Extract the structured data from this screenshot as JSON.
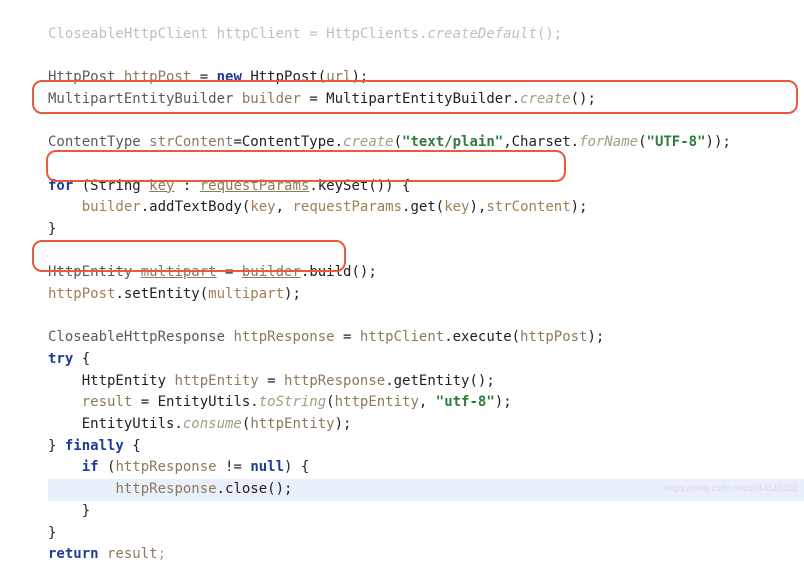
{
  "code": {
    "l00a": "CloseableHttpClient ",
    "l00b": "httpClient",
    "l00c": " = HttpClients.",
    "l00d": "createDefault",
    "l00e": "();",
    "l02a": "HttpPost ",
    "l02b": "httpPost",
    "l02c": " = ",
    "l02d": "new",
    "l02e": " HttpPost(",
    "l02f": "url",
    "l02g": ");",
    "l03a": "MultipartEntityBuilder ",
    "l03b": "builder",
    "l03c": " = MultipartEntityBuilder.",
    "l03d": "create",
    "l03e": "();",
    "l05a": "ContentType ",
    "l05b": "strContent",
    "l05c": "=ContentType.",
    "l05d": "create",
    "l05e": "(",
    "l05f": "\"text/plain\"",
    "l05g": ",Charset.",
    "l05h": "forName",
    "l05i": "(",
    "l05j": "\"UTF-8\"",
    "l05k": "));",
    "l07a": "for",
    "l07b": " (String ",
    "l07c": "key",
    "l07d": " : ",
    "l07e": "requestParams",
    "l07f": ".keySet()) {",
    "l08a": "    ",
    "l08b": "builder",
    "l08c": ".addTextBody(",
    "l08d": "key",
    "l08e": ", ",
    "l08f": "requestParams",
    "l08g": ".get(",
    "l08h": "key",
    "l08i": "),",
    "l08j": "strContent",
    "l08k": ");",
    "l09a": "}",
    "l11a": "HttpEntity ",
    "l11b": "multipart",
    "l11c": " = ",
    "l11d": "builder",
    "l11e": ".build();",
    "l12a": "httpPost",
    "l12b": ".setEntity(",
    "l12c": "multipart",
    "l12d": ");",
    "l14a": "CloseableHttpResponse ",
    "l14b": "httpResponse",
    "l14c": " = ",
    "l14d": "httpClient",
    "l14e": ".execute(",
    "l14f": "httpPost",
    "l14g": ");",
    "l15a": "try",
    "l15b": " {",
    "l16a": "    HttpEntity ",
    "l16b": "httpEntity",
    "l16c": " = ",
    "l16d": "httpResponse",
    "l16e": ".getEntity();",
    "l17a": "    ",
    "l17b": "result",
    "l17c": " = EntityUtils.",
    "l17d": "toString",
    "l17e": "(",
    "l17f": "httpEntity",
    "l17g": ", ",
    "l17h": "\"utf-8\"",
    "l17i": ");",
    "l18a": "    EntityUtils.",
    "l18b": "consume",
    "l18c": "(",
    "l18d": "httpEntity",
    "l18e": ");",
    "l19a": "} ",
    "l19b": "finally",
    "l19c": " {",
    "l20a": "    ",
    "l20b": "if",
    "l20c": " (",
    "l20d": "httpResponse",
    "l20e": " != ",
    "l20f": "null",
    "l20g": ") {",
    "l21a": "        ",
    "l21b": "httpResponse",
    "l21c": ".close();",
    "l22a": "    }",
    "l23a": "}",
    "l24a": "return",
    "l24b": " ",
    "l24c": "result",
    "l24d": ";"
  },
  "watermark": "https://blog.csdn.net/u014510302"
}
